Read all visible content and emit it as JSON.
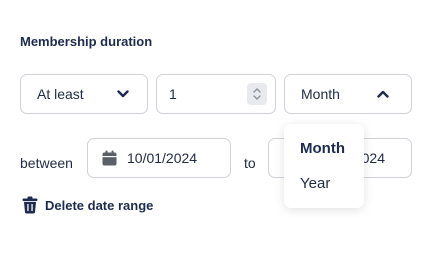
{
  "section_title": "Membership duration",
  "qualifier": {
    "selected": "At least"
  },
  "quantity": {
    "value": "1"
  },
  "unit": {
    "selected": "Month",
    "options": [
      "Month",
      "Year"
    ]
  },
  "range": {
    "between_label": "between",
    "start_date": "10/01/2024",
    "to_label": "to",
    "end_date_visible": "024"
  },
  "actions": {
    "delete_label": "Delete date range"
  },
  "colors": {
    "text": "#1d2b4f",
    "border": "#cfd3d9",
    "icon": "#5b5f66"
  }
}
